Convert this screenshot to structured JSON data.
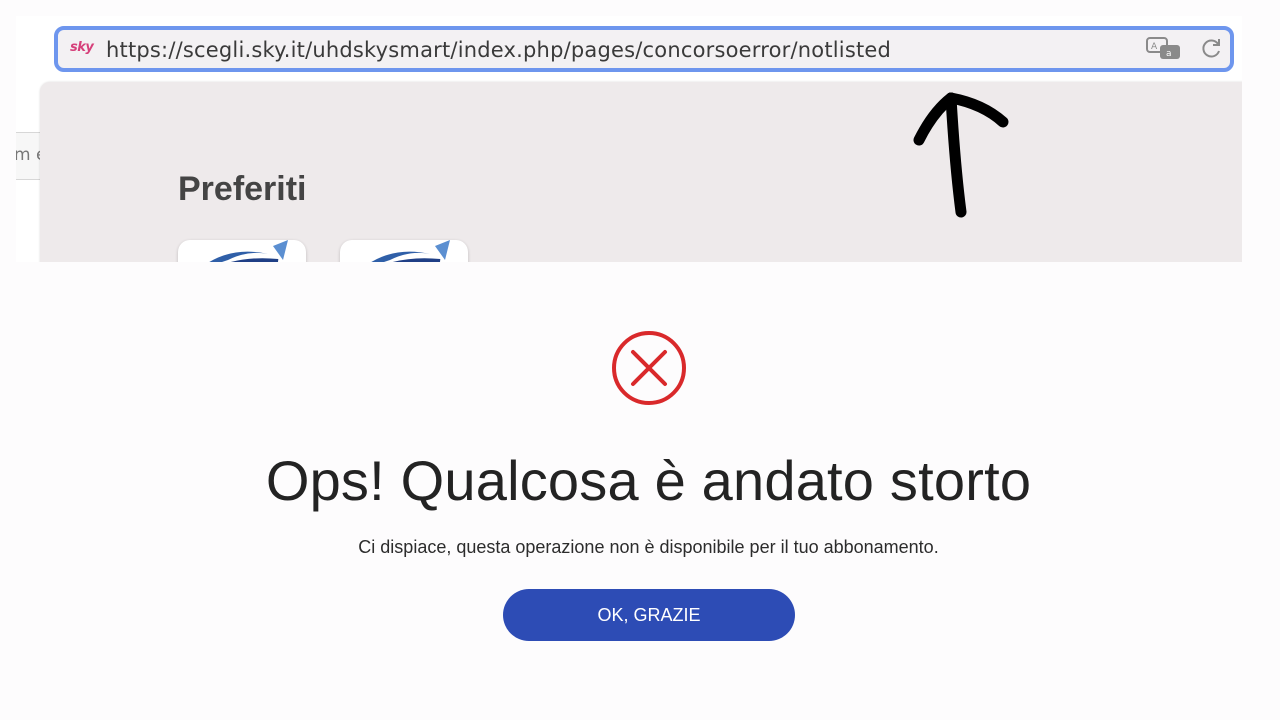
{
  "browser": {
    "favicon_text": "sky",
    "url": "https://scegli.sky.it/uhdskysmart/index.php/pages/concorsoerror/notlisted",
    "translate_icon": "translate-icon",
    "reload_icon": "reload-icon",
    "partial_left_text": "m e"
  },
  "favorites": {
    "heading": "Preferiti",
    "tiles": [
      {
        "icon": "browser-logo-icon"
      },
      {
        "icon": "browser-logo-icon"
      }
    ]
  },
  "annotation": {
    "icon": "hand-drawn-arrow-icon"
  },
  "error_dialog": {
    "icon": "error-x-circle-icon",
    "title": "Ops! Qualcosa è andato storto",
    "message": "Ci dispiace, questa operazione non è disponibile per il tuo abbonamento.",
    "button_label": "OK, GRAZIE"
  },
  "colors": {
    "accent_button": "#2d4cb5",
    "error_red": "#d9292b",
    "address_bar_border": "#6e96ee",
    "annotation_ink": "#000000"
  }
}
